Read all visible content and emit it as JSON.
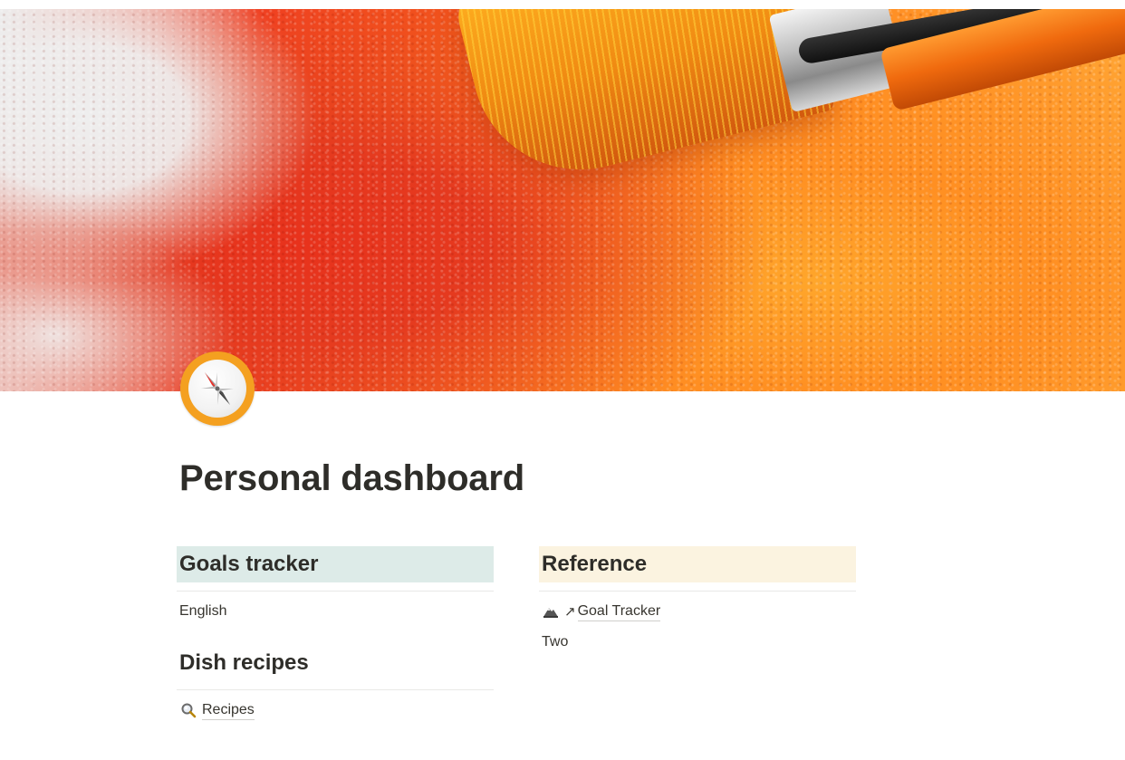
{
  "page": {
    "title": "Personal dashboard",
    "icon": "compass-icon"
  },
  "left_column": {
    "goals": {
      "heading": "Goals tracker",
      "heading_bg": "#ddebe8",
      "items": [
        "English"
      ]
    },
    "dishes": {
      "heading": "Dish recipes",
      "link": {
        "icon": "magnifying-glass-icon",
        "label": "Recipes"
      }
    }
  },
  "right_column": {
    "reference": {
      "heading": "Reference",
      "heading_bg": "#fbf3e0",
      "link": {
        "icon": "mountain-icon",
        "arrow": "↗",
        "label": "Goal Tracker"
      },
      "items": [
        "Two"
      ]
    }
  },
  "colors": {
    "text": "#37352f",
    "divider": "#e9e9e7",
    "icon_ring": "#f4a020"
  }
}
